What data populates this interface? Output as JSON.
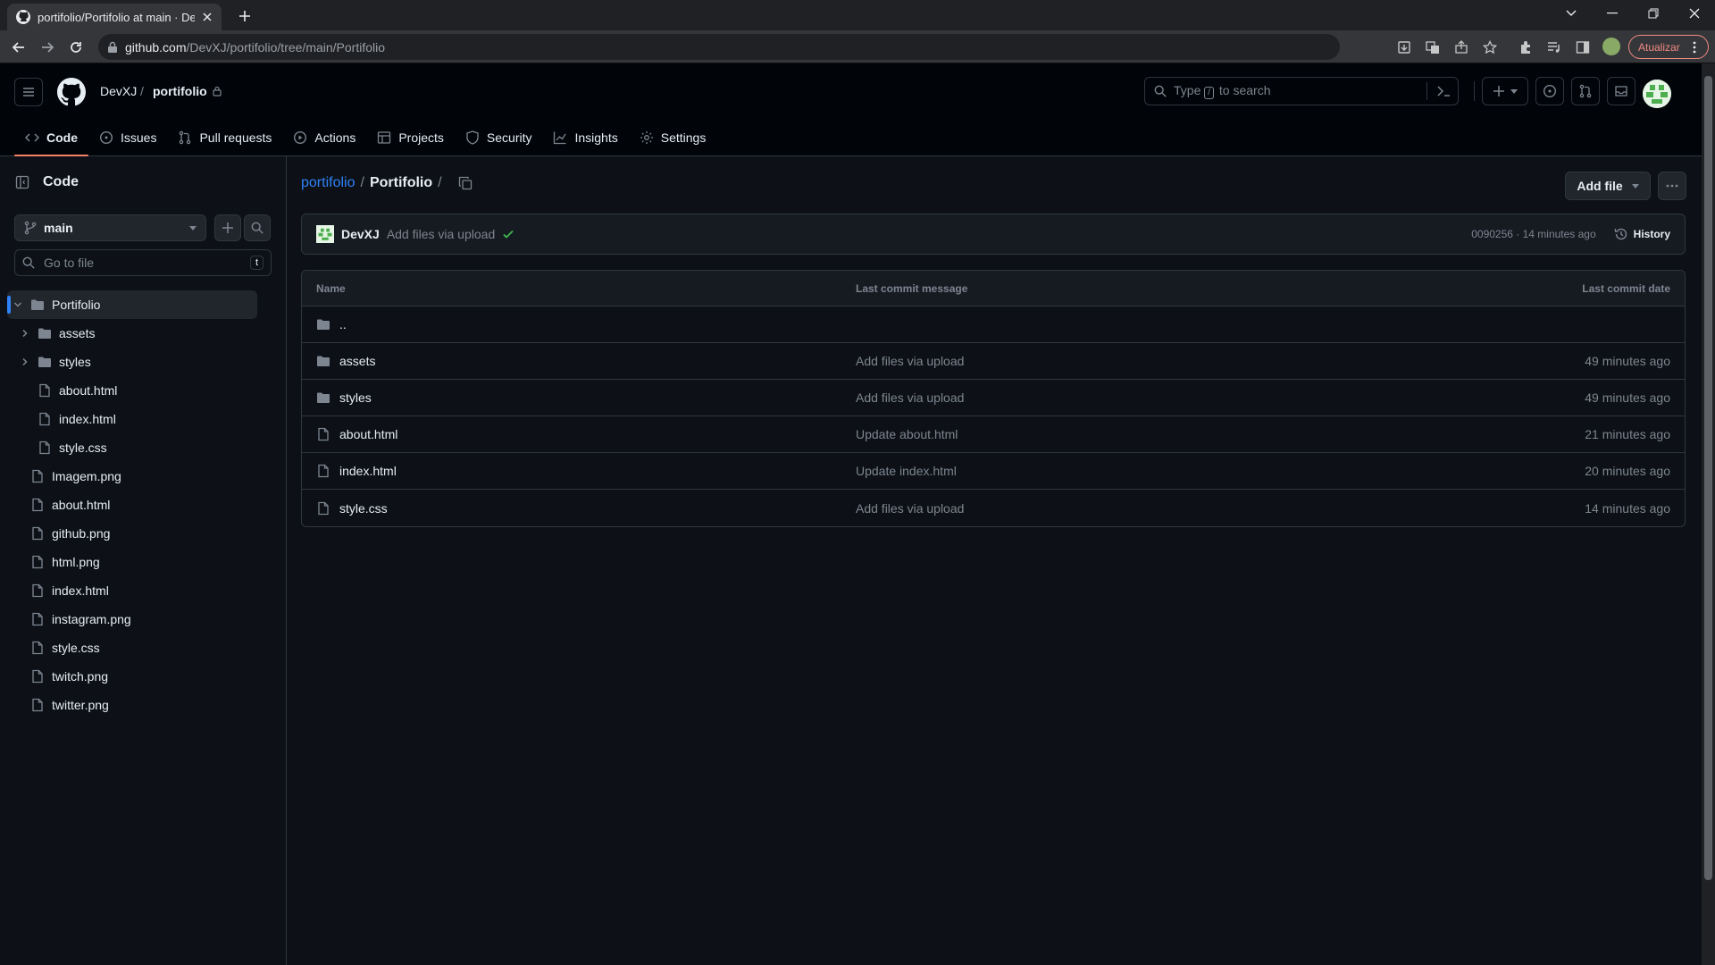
{
  "browser": {
    "tab_title": "portifolio/Portifolio at main · Dev",
    "url_host": "github.com",
    "url_path": "/DevXJ/portifolio/tree/main/Portifolio",
    "update_label": "Atualizar"
  },
  "header": {
    "owner": "DevXJ",
    "separator": "/",
    "repo": "portifolio",
    "search_prefix": "Type",
    "search_key": "/",
    "search_suffix": "to search"
  },
  "nav": {
    "code": "Code",
    "issues": "Issues",
    "pulls": "Pull requests",
    "actions": "Actions",
    "projects": "Projects",
    "security": "Security",
    "insights": "Insights",
    "settings": "Settings"
  },
  "sidebar": {
    "title": "Code",
    "branch": "main",
    "goto_placeholder": "Go to file",
    "goto_key": "t",
    "tree": [
      {
        "label": "Portifolio",
        "type": "folder",
        "depth": 0,
        "expanded": true,
        "selected": true
      },
      {
        "label": "assets",
        "type": "folder",
        "depth": 1,
        "expanded": false
      },
      {
        "label": "styles",
        "type": "folder",
        "depth": 1,
        "expanded": false
      },
      {
        "label": "about.html",
        "type": "file",
        "depth": 1
      },
      {
        "label": "index.html",
        "type": "file",
        "depth": 1
      },
      {
        "label": "style.css",
        "type": "file",
        "depth": 1
      },
      {
        "label": "Imagem.png",
        "type": "file",
        "depth": 0
      },
      {
        "label": "about.html",
        "type": "file",
        "depth": 0
      },
      {
        "label": "github.png",
        "type": "file",
        "depth": 0
      },
      {
        "label": "html.png",
        "type": "file",
        "depth": 0
      },
      {
        "label": "index.html",
        "type": "file",
        "depth": 0
      },
      {
        "label": "instagram.png",
        "type": "file",
        "depth": 0
      },
      {
        "label": "style.css",
        "type": "file",
        "depth": 0
      },
      {
        "label": "twitch.png",
        "type": "file",
        "depth": 0
      },
      {
        "label": "twitter.png",
        "type": "file",
        "depth": 0
      }
    ]
  },
  "main": {
    "crumb_root": "portifolio",
    "crumb_sep": "/",
    "crumb_current": "Portifolio",
    "crumb_trail": "/",
    "add_file": "Add file",
    "commit": {
      "author": "DevXJ",
      "message": "Add files via upload",
      "hash_time": "0090256 · 14 minutes ago",
      "history": "History"
    },
    "columns": {
      "name": "Name",
      "message": "Last commit message",
      "date": "Last commit date"
    },
    "rows": [
      {
        "name": "..",
        "type": "folder",
        "message": "",
        "date": ""
      },
      {
        "name": "assets",
        "type": "folder",
        "message": "Add files via upload",
        "date": "49 minutes ago"
      },
      {
        "name": "styles",
        "type": "folder",
        "message": "Add files via upload",
        "date": "49 minutes ago"
      },
      {
        "name": "about.html",
        "type": "file",
        "message": "Update about.html",
        "date": "21 minutes ago"
      },
      {
        "name": "index.html",
        "type": "file",
        "message": "Update index.html",
        "date": "20 minutes ago"
      },
      {
        "name": "style.css",
        "type": "file",
        "message": "Add files via upload",
        "date": "14 minutes ago"
      }
    ]
  },
  "colors": {
    "accent_blue": "#2f81f7",
    "nav_underline": "#f78166",
    "success": "#3fb950",
    "background": "#0d1117"
  }
}
